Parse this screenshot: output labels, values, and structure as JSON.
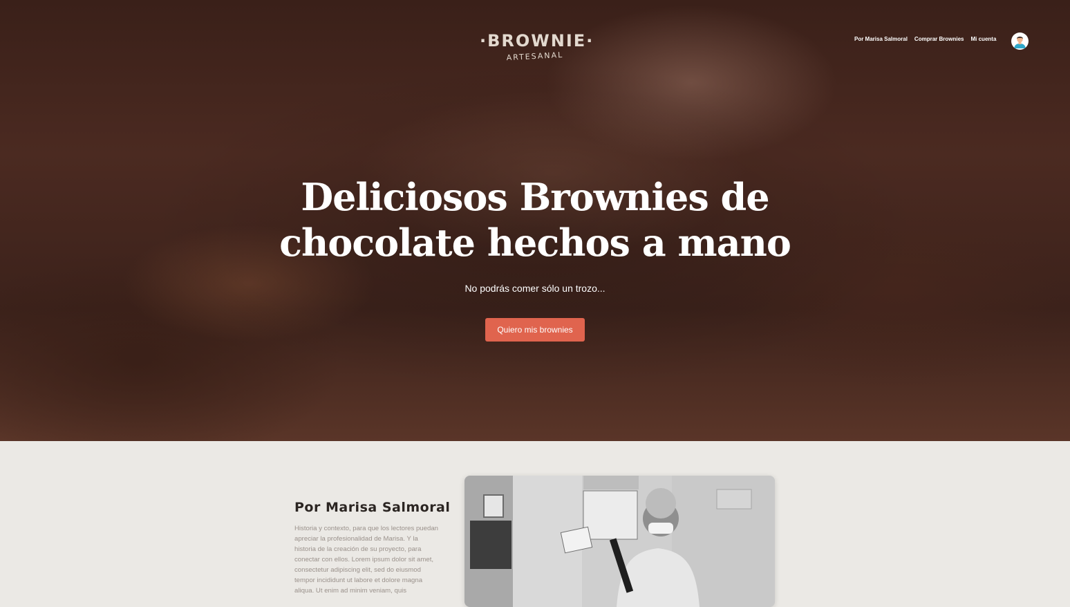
{
  "header": {
    "logo_main": "·BROWNIE·",
    "logo_sub": "ARTESANAL",
    "nav": [
      "Por Marisa Salmoral",
      "Comprar Brownies",
      "Mi cuenta"
    ],
    "avatar_icon": "user-avatar-icon"
  },
  "hero": {
    "title_line1": "Deliciosos Brownies de",
    "title_line2": "chocolate hechos a mano",
    "subtitle": "No podrás comer sólo un trozo...",
    "cta_label": "Quiero mis brownies"
  },
  "about": {
    "title": "Por Marisa Salmoral",
    "text": "Historia y contexto, para que los lectores puedan apreciar la profesionalidad de Marisa. Y la historia de la creación de su proyecto, para conectar con ellos. Lorem ipsum dolor sit amet, consectetur adipiscing elit, sed do eiusmod tempor incididunt ut labore et dolore magna aliqua. Ut enim ad minim veniam, quis"
  },
  "colors": {
    "accent": "#e0644e",
    "section_bg": "#ebe9e5",
    "heading": "#2b2522",
    "body_text": "#9a918b"
  }
}
